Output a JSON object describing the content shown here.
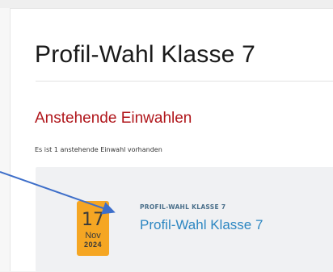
{
  "page": {
    "title": "Profil-Wahl Klasse 7"
  },
  "section": {
    "title": "Anstehende Einwahlen",
    "subtitle": "Es ist 1 anstehende Einwahl vorhanden"
  },
  "event": {
    "date": {
      "day": "17",
      "month": "Nov",
      "year": "2024"
    },
    "category": "PROFIL-WAHL KLASSE 7",
    "title": "Profil-Wahl Klasse 7"
  },
  "colors": {
    "section_title": "#b0161b",
    "date_badge": "#f5a623",
    "link": "#2d87c2",
    "category": "#4a6f8a",
    "annotation_arrow": "#3d6ec9"
  }
}
